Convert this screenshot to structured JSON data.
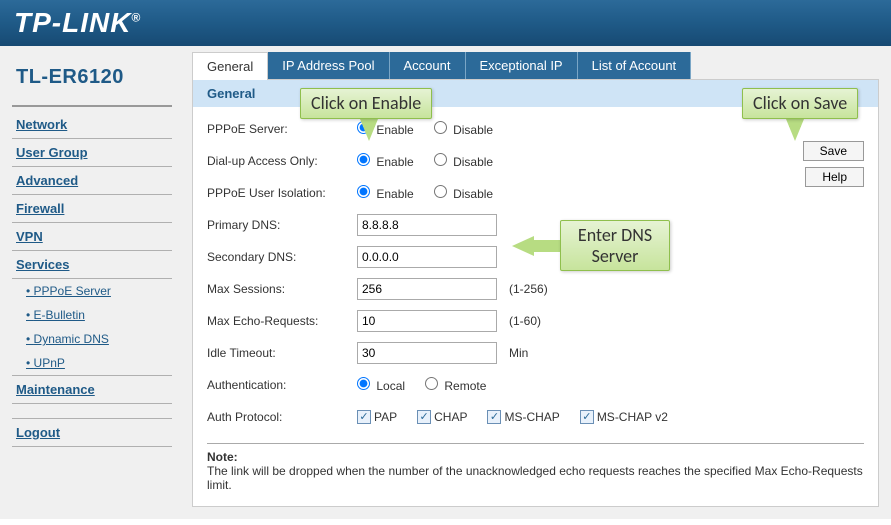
{
  "logo": "TP-LINK",
  "model": "TL-ER6120",
  "sidebar": {
    "items": [
      {
        "label": "Network"
      },
      {
        "label": "User Group"
      },
      {
        "label": "Advanced"
      },
      {
        "label": "Firewall"
      },
      {
        "label": "VPN"
      },
      {
        "label": "Services"
      }
    ],
    "subitems": [
      {
        "label": "PPPoE Server"
      },
      {
        "label": "E-Bulletin"
      },
      {
        "label": "Dynamic DNS"
      },
      {
        "label": "UPnP"
      }
    ],
    "maintenance": "Maintenance",
    "logout": "Logout"
  },
  "tabs": [
    {
      "label": "General"
    },
    {
      "label": "IP Address Pool"
    },
    {
      "label": "Account"
    },
    {
      "label": "Exceptional IP"
    },
    {
      "label": "List of Account"
    }
  ],
  "section_title": "General",
  "form": {
    "pppoe_server": {
      "label": "PPPoE Server:",
      "opt1": "Enable",
      "opt2": "Disable"
    },
    "dialup": {
      "label": "Dial-up Access Only:",
      "opt1": "Enable",
      "opt2": "Disable"
    },
    "isolation": {
      "label": "PPPoE User Isolation:",
      "opt1": "Enable",
      "opt2": "Disable"
    },
    "primary_dns": {
      "label": "Primary DNS:",
      "value": "8.8.8.8"
    },
    "secondary_dns": {
      "label": "Secondary DNS:",
      "value": "0.0.0.0"
    },
    "max_sessions": {
      "label": "Max Sessions:",
      "value": "256",
      "hint": "(1-256)"
    },
    "max_echo": {
      "label": "Max Echo-Requests:",
      "value": "10",
      "hint": "(1-60)"
    },
    "idle": {
      "label": "Idle Timeout:",
      "value": "30",
      "hint": "Min"
    },
    "auth": {
      "label": "Authentication:",
      "opt1": "Local",
      "opt2": "Remote"
    },
    "auth_proto": {
      "label": "Auth Protocol:",
      "p1": "PAP",
      "p2": "CHAP",
      "p3": "MS-CHAP",
      "p4": "MS-CHAP v2"
    }
  },
  "buttons": {
    "save": "Save",
    "help": "Help"
  },
  "note": {
    "title": "Note:",
    "text": "The link will be dropped when the number of the unacknowledged echo requests reaches the specified Max Echo-Requests limit."
  },
  "callouts": {
    "enable": "Click on Enable",
    "save": "Click on Save",
    "dns_l1": "Enter DNS",
    "dns_l2": "Server"
  }
}
